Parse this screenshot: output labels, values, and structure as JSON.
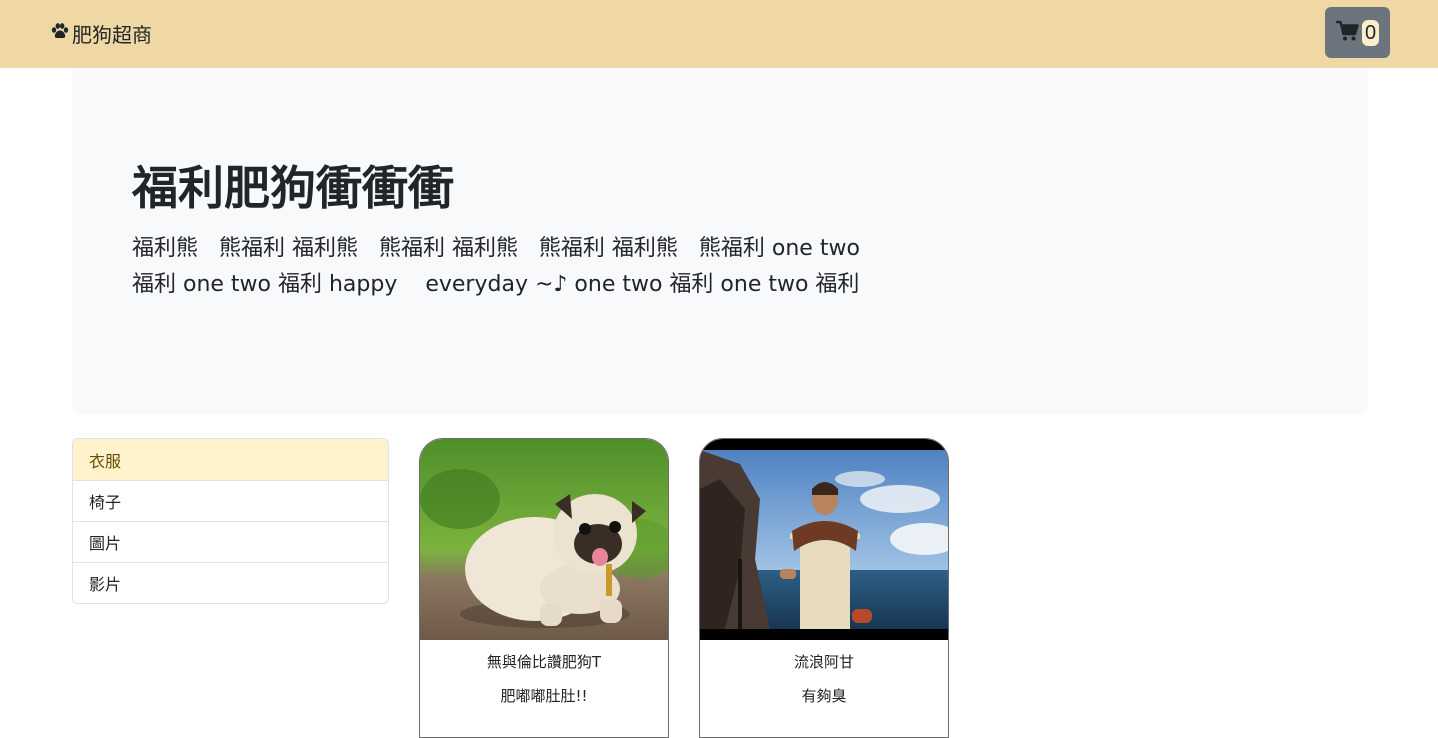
{
  "navbar": {
    "brand_icon": "paw-icon",
    "brand": "肥狗超商",
    "cart_icon": "cart-icon",
    "cart_count": "0",
    "background": "#f0d8a4"
  },
  "jumbotron": {
    "title": "福利肥狗衝衝衝",
    "lead": "福利熊   熊福利 福利熊   熊福利 福利熊   熊福利 福利熊   熊福利 one two\n福利 one two 福利 happy    everyday ~♪ one two 福利 one two 福利"
  },
  "categories": [
    {
      "label": "衣服",
      "active": true
    },
    {
      "label": "椅子",
      "active": false
    },
    {
      "label": "圖片",
      "active": false
    },
    {
      "label": "影片",
      "active": false
    }
  ],
  "products": [
    {
      "title": "無與倫比讚肥狗T",
      "text": "肥嘟嘟肚肚!!",
      "image": "pug-photo"
    },
    {
      "title": "流浪阿甘",
      "text": "有夠臭",
      "image": "castaway-photo"
    }
  ]
}
